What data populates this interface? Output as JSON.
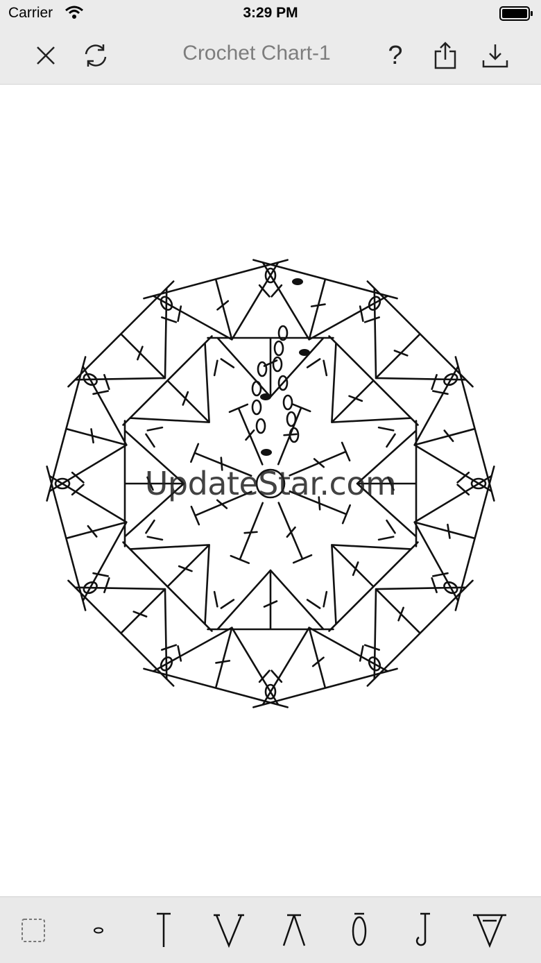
{
  "status": {
    "carrier": "Carrier",
    "time": "3:29 PM"
  },
  "nav": {
    "title": "Crochet Chart-1",
    "help_label": "?"
  },
  "watermark": "UpdateStar.com",
  "toolbar": {
    "tools": [
      {
        "name": "select-tool",
        "icon": "dashed-square-icon"
      },
      {
        "name": "chain-stitch-tool",
        "icon": "chain-oval-icon"
      },
      {
        "name": "double-crochet-tool",
        "icon": "double-crochet-icon"
      },
      {
        "name": "v-stitch-tool",
        "icon": "v-stitch-icon"
      },
      {
        "name": "decrease-stitch-tool",
        "icon": "decrease-icon"
      },
      {
        "name": "popcorn-stitch-tool",
        "icon": "popcorn-icon"
      },
      {
        "name": "hook-stitch-tool",
        "icon": "hook-icon"
      },
      {
        "name": "shell-stitch-tool",
        "icon": "shell-icon"
      }
    ]
  },
  "chart_motifs": {
    "rings": 3,
    "inner_ring_stitches": 8,
    "middle_ring_fans": 8,
    "outer_ring_fans": 12
  }
}
